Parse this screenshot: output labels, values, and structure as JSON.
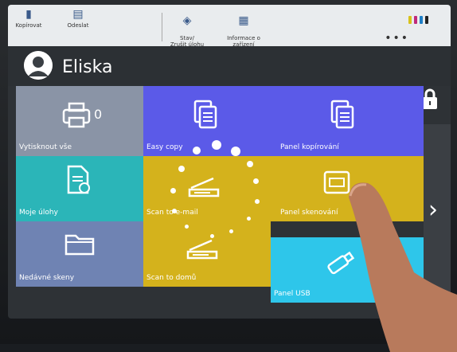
{
  "topbar": {
    "copy_label": "Kopírovat",
    "send_label": "Odeslat",
    "status_label": "Stav/\nZrušit úlohu",
    "info_label": "Informace o\nzařízení",
    "more_label": "•••"
  },
  "user": {
    "name": "Eliska"
  },
  "tiles": {
    "print_all": {
      "label": "Vytisknout vše",
      "count": "0"
    },
    "easy_copy": {
      "label": "Easy copy"
    },
    "panel_copy": {
      "label": "Panel kopírování"
    },
    "my_jobs": {
      "label": "Moje úlohy"
    },
    "scan_email": {
      "label": "Scan to e-mail"
    },
    "panel_scan": {
      "label": "Panel skenování"
    },
    "recent_scans": {
      "label": "Nedávné skeny"
    },
    "scan_home": {
      "label": "Scan to domů"
    },
    "panel_usb": {
      "label": "Panel USB"
    }
  },
  "colors": {
    "gray_tile": "#8a94a6",
    "blue_tile": "#5b5ae8",
    "teal_tile": "#2bb5b8",
    "yellow_tile": "#d4b21c",
    "cyan_tile": "#2ec6ea",
    "slate_tile": "#6f83b3"
  }
}
